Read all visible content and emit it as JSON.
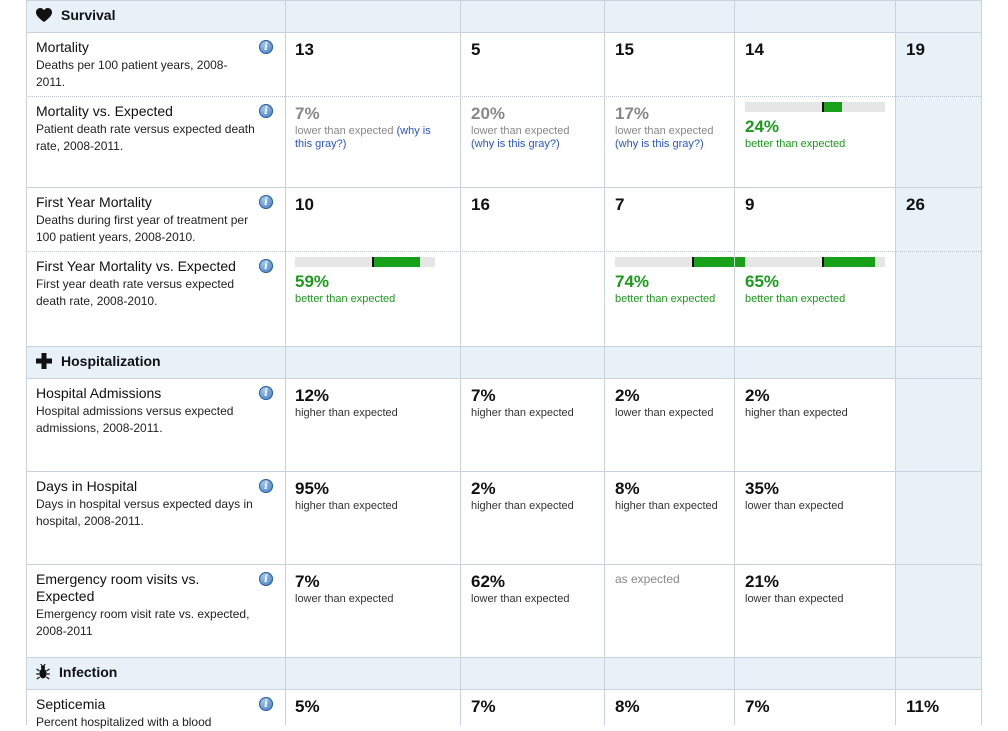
{
  "sections": [
    {
      "name": "Survival",
      "icon": "heart-icon",
      "rows": [
        {
          "title": "Mortality",
          "desc": "Deaths per 100 patient years, 2008-2011.",
          "cells": [
            {
              "value": "13"
            },
            {
              "value": "5"
            },
            {
              "value": "15"
            },
            {
              "value": "14"
            },
            {
              "value": "19"
            }
          ]
        },
        {
          "title": "Mortality vs. Expected",
          "desc": "Patient death rate versus expected death rate, 2008-2011.",
          "cells": [
            {
              "value": "7%",
              "style": "gray",
              "note": "lower than expected",
              "link": "(why is this gray?)"
            },
            {
              "value": "20%",
              "style": "gray",
              "note": "lower than expected",
              "link": "(why is this gray?)"
            },
            {
              "value": "17%",
              "style": "gray",
              "note": "lower than expected",
              "link": "(why is this gray?)"
            },
            {
              "value": "24%",
              "style": "green",
              "note": "better than expected",
              "bar": 24
            },
            {}
          ]
        },
        {
          "title": "First Year Mortality",
          "desc": "Deaths during first year of treatment per 100 patient years, 2008-2010.",
          "cells": [
            {
              "value": "10"
            },
            {
              "value": "16"
            },
            {
              "value": "7"
            },
            {
              "value": "9"
            },
            {
              "value": "26"
            }
          ]
        },
        {
          "title": "First Year Mortality vs. Expected",
          "desc": "First year death rate versus expected death rate, 2008-2010.",
          "cells": [
            {
              "value": "59%",
              "style": "green",
              "note": "better than expected",
              "bar": 59
            },
            {},
            {
              "value": "74%",
              "style": "green",
              "note": "better than expected",
              "bar": 74
            },
            {
              "value": "65%",
              "style": "green",
              "note": "better than expected",
              "bar": 65
            },
            {}
          ]
        }
      ]
    },
    {
      "name": "Hospitalization",
      "icon": "cross-icon",
      "rows": [
        {
          "title": "Hospital Admissions",
          "desc": "Hospital admissions versus expected admissions, 2008-2011.",
          "cells": [
            {
              "value": "12%",
              "note": "higher than expected"
            },
            {
              "value": "7%",
              "note": "higher than expected"
            },
            {
              "value": "2%",
              "note": "lower than expected"
            },
            {
              "value": "2%",
              "note": "higher than expected"
            },
            {}
          ]
        },
        {
          "title": "Days in Hospital",
          "desc": "Days in hospital versus expected days in hospital, 2008-2011.",
          "cells": [
            {
              "value": "95%",
              "note": "higher than expected"
            },
            {
              "value": "2%",
              "note": "higher than expected"
            },
            {
              "value": "8%",
              "note": "higher than expected"
            },
            {
              "value": "35%",
              "note": "lower than expected"
            },
            {}
          ]
        },
        {
          "title": "Emergency room visits vs. Expected",
          "desc": "Emergency room visit rate vs. expected, 2008-2011",
          "cells": [
            {
              "value": "7%",
              "note": "lower than expected"
            },
            {
              "value": "62%",
              "note": "lower than expected"
            },
            {
              "plain": "as expected"
            },
            {
              "value": "21%",
              "note": "lower than expected"
            },
            {}
          ]
        }
      ]
    },
    {
      "name": "Infection",
      "icon": "bug-icon",
      "rows": [
        {
          "title": "Septicemia",
          "desc": "Percent hospitalized with a blood",
          "cells": [
            {
              "value": "5%"
            },
            {
              "value": "7%"
            },
            {
              "value": "8%"
            },
            {
              "value": "7%"
            },
            {
              "value": "11%"
            }
          ]
        }
      ]
    }
  ],
  "info_icon_glyph": "i",
  "colors": {
    "section_bg": "#e8f0f8",
    "grid_line": "#c9d3de",
    "better_green": "#1c9a1c",
    "bar_fill": "#18a018",
    "link_blue": "#2a55c8",
    "muted_gray": "#888888"
  }
}
